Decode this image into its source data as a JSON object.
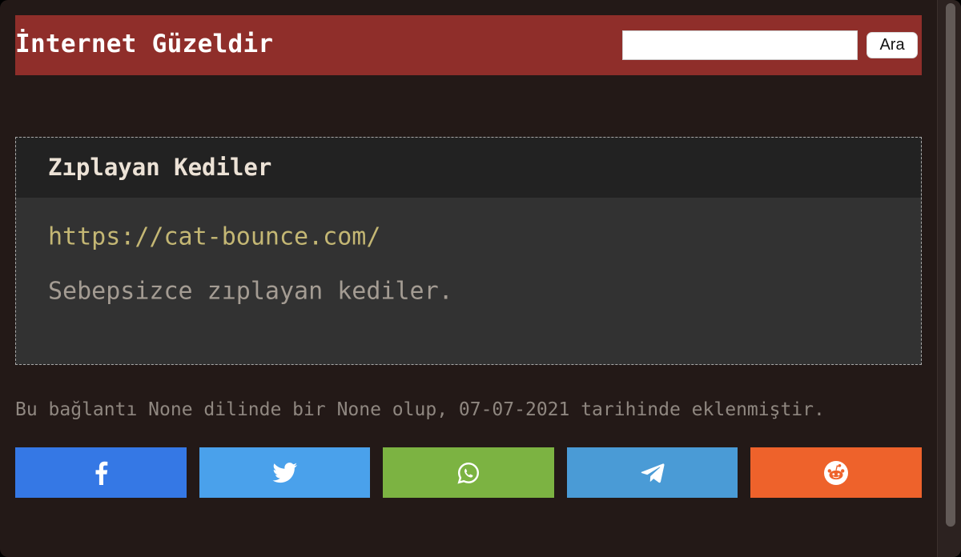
{
  "header": {
    "site_title": "İnternet Güzeldir",
    "search_value": "",
    "search_button_label": "Ara"
  },
  "card": {
    "title": "Zıplayan Kediler",
    "url": "https://cat-bounce.com/",
    "description": "Sebepsizce zıplayan kediler."
  },
  "meta_text": "Bu bağlantı None dilinde bir None olup, 07-07-2021 tarihinde eklenmiştir.",
  "share_buttons": [
    {
      "icon": "facebook-icon",
      "color": "#3578e5"
    },
    {
      "icon": "twitter-icon",
      "color": "#4aa1eb"
    },
    {
      "icon": "whatsapp-icon",
      "color": "#7cb342"
    },
    {
      "icon": "telegram-icon",
      "color": "#4a9bd6"
    },
    {
      "icon": "reddit-icon",
      "color": "#ee622b"
    }
  ],
  "colors": {
    "background": "#231917",
    "header": "#8f2e2a",
    "card_body": "#323232",
    "card_head": "#222222",
    "link": "#c4b774"
  }
}
